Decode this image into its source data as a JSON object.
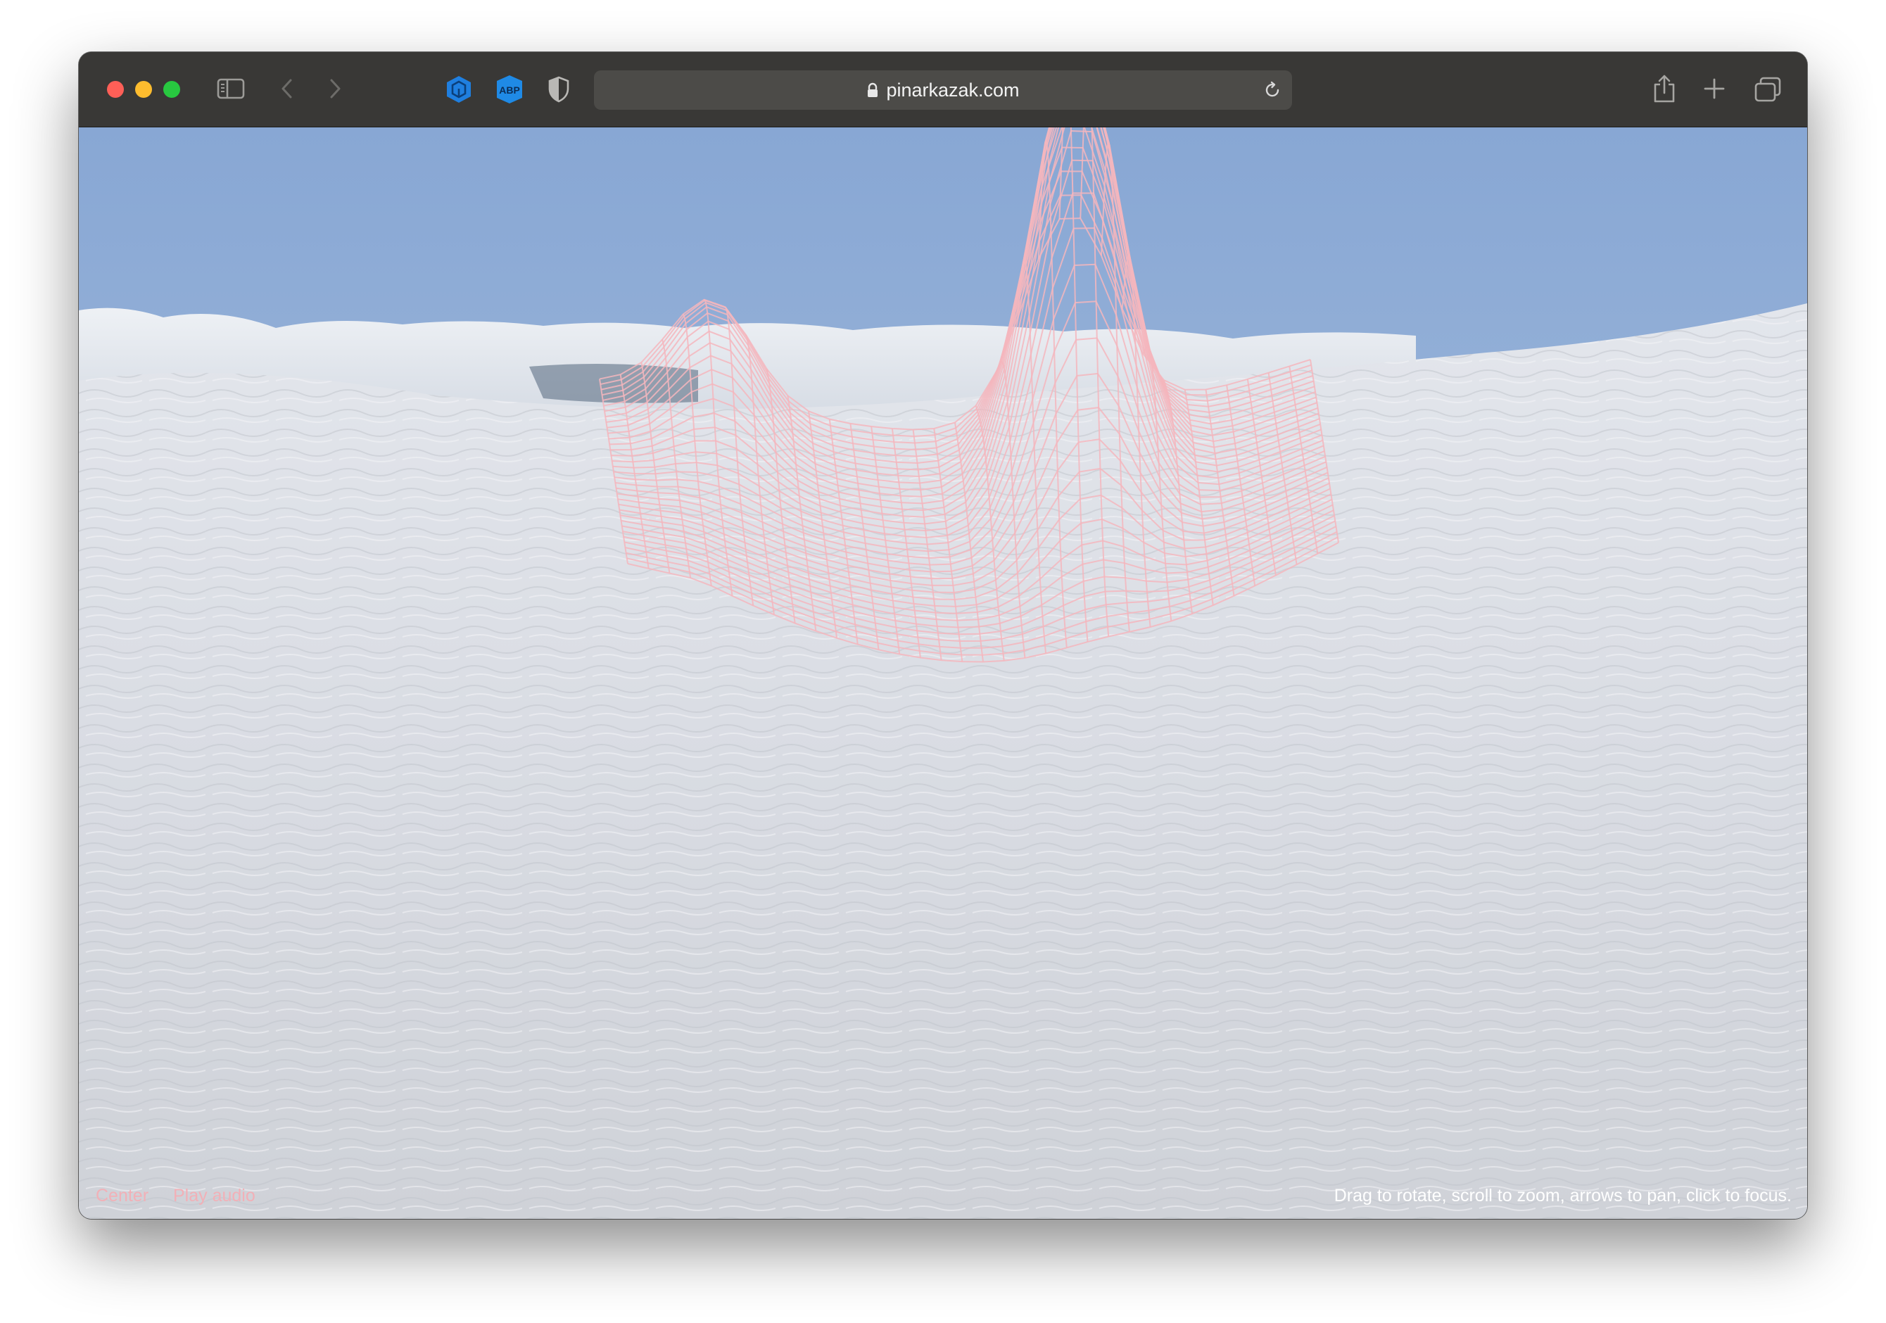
{
  "browser": {
    "url": "pinarkazak.com",
    "toolbar_icons": [
      "sidebar-icon",
      "back-icon",
      "forward-icon",
      "extension-hexagon-icon",
      "adblock-plus-icon",
      "privacy-shield-icon",
      "reload-icon",
      "share-icon",
      "new-tab-icon",
      "tab-overview-icon"
    ],
    "extension_abp_label": "ABP"
  },
  "page": {
    "controls": {
      "center_label": "Center",
      "play_audio_label": "Play audio"
    },
    "instructions": "Drag to rotate, scroll to zoom, arrows to pan, click to focus.",
    "mesh_color": "#f4b6bd",
    "sky_color": "#8aaad6",
    "snow_color": "#d9dce2"
  }
}
